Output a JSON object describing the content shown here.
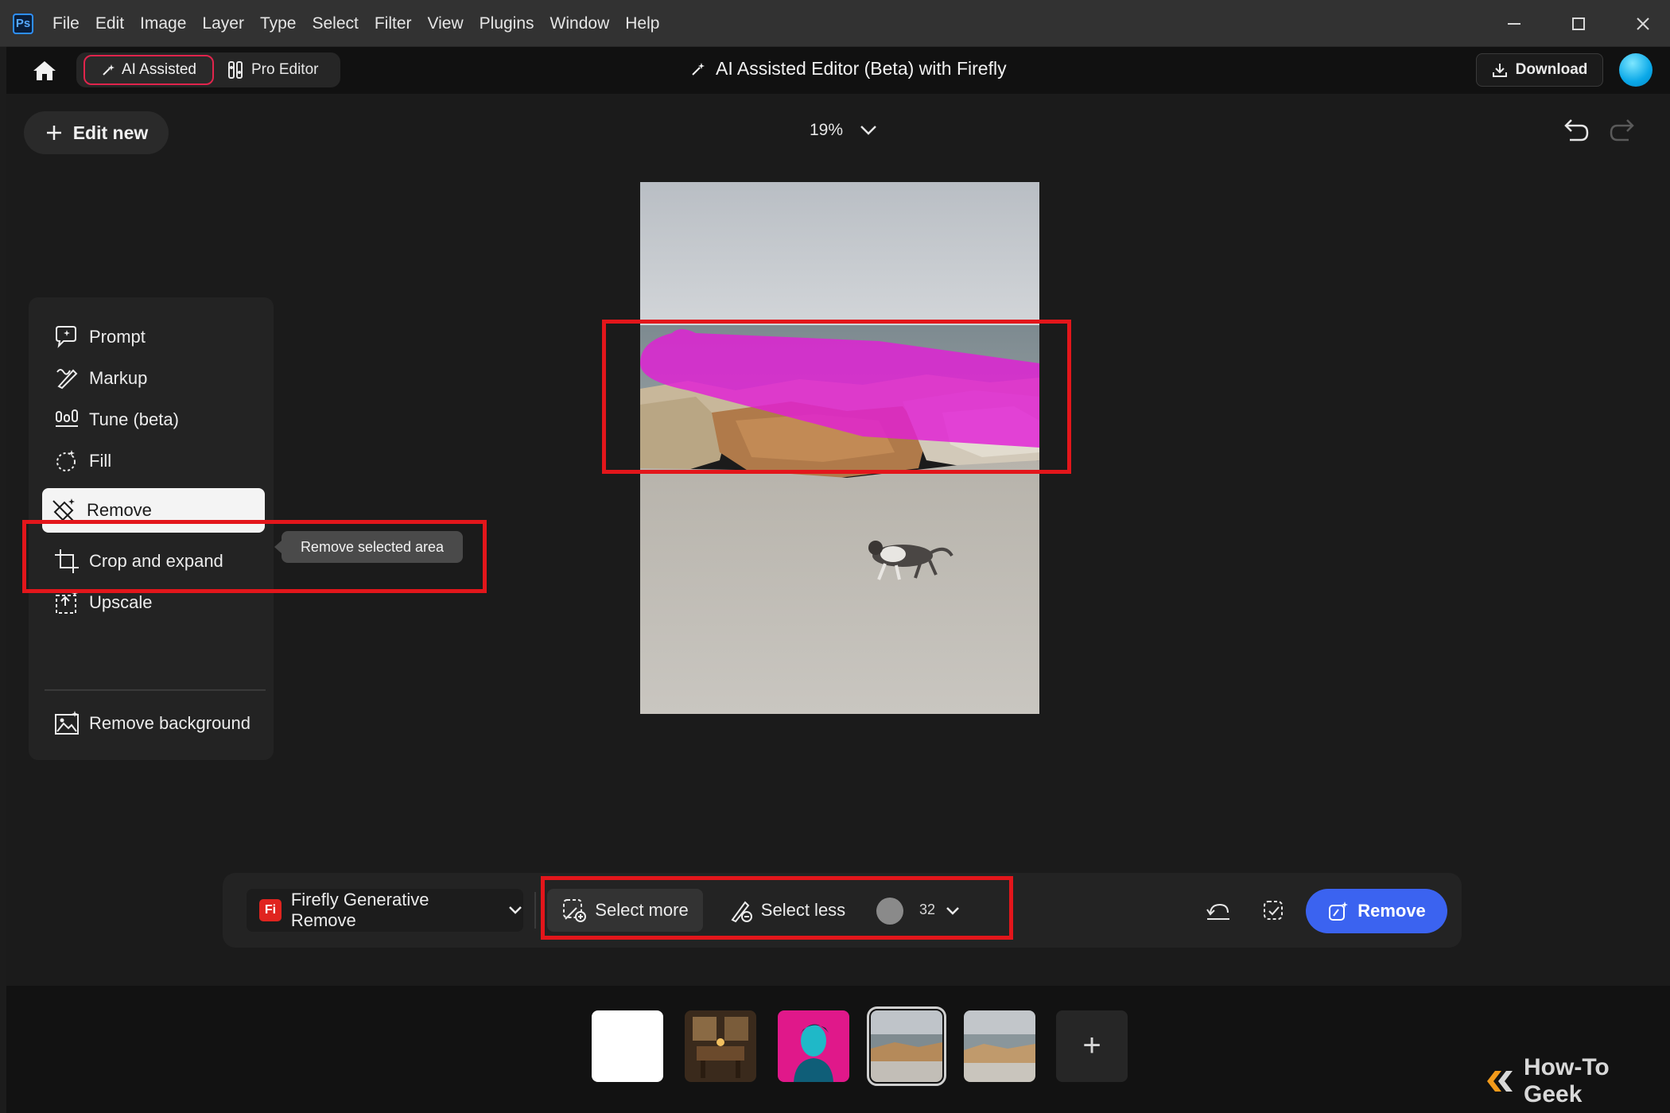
{
  "app": {
    "logo": "Ps",
    "menu": [
      "File",
      "Edit",
      "Image",
      "Layer",
      "Type",
      "Select",
      "Filter",
      "View",
      "Plugins",
      "Window",
      "Help"
    ]
  },
  "header": {
    "mode_ai": "AI Assisted",
    "mode_pro": "Pro Editor",
    "title": "AI Assisted Editor (Beta) with Firefly",
    "download": "Download"
  },
  "workspace": {
    "edit_new": "Edit new",
    "zoom": "19%"
  },
  "tools": {
    "items": [
      {
        "label": "Prompt",
        "icon": "prompt-icon"
      },
      {
        "label": "Markup",
        "icon": "markup-icon"
      },
      {
        "label": "Tune (beta)",
        "icon": "tune-icon"
      },
      {
        "label": "Fill",
        "icon": "fill-icon"
      },
      {
        "label": "Remove",
        "icon": "remove-icon",
        "active": true
      },
      {
        "label": "Crop and expand",
        "icon": "crop-icon"
      },
      {
        "label": "Upscale",
        "icon": "upscale-icon"
      },
      {
        "label": "Remove background",
        "icon": "remove-background-icon"
      }
    ],
    "tooltip": "Remove selected area"
  },
  "toolbar": {
    "model_logo": "Fi",
    "model": "Firefly Generative Remove",
    "select_more": "Select more",
    "select_less": "Select less",
    "brush_size": "32",
    "remove": "Remove"
  },
  "filmstrip": {
    "add": "+"
  },
  "watermark": "How-To Geek",
  "colors": {
    "accent_red": "#e3161b",
    "primary_blue": "#3b63f0",
    "mask_magenta": "#e21fd6"
  }
}
